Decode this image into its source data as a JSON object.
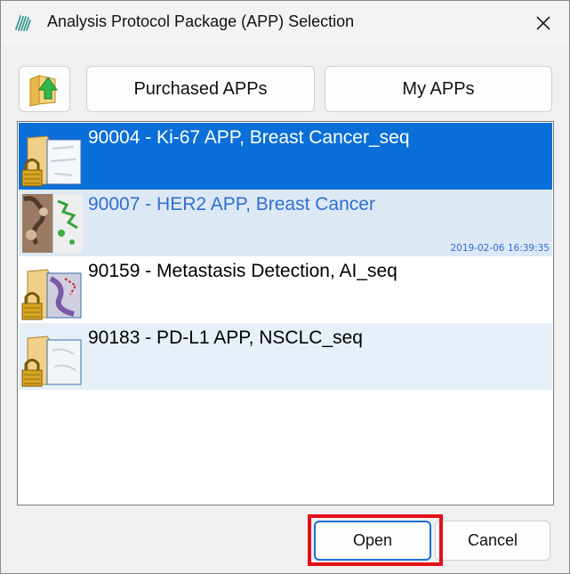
{
  "window": {
    "title": "Analysis Protocol Package (APP) Selection",
    "icon": "app-logo-icon",
    "close_icon": "close-icon"
  },
  "toolbar": {
    "folder_up_icon": "folder-up-icon",
    "purchased_label": "Purchased APPs",
    "myapps_label": "My APPs"
  },
  "list": {
    "items": [
      {
        "label": "90004 - Ki-67 APP, Breast Cancer_seq",
        "timestamp": "",
        "state": "selected",
        "locked": true,
        "icon": "locked-folder-thumbnail-icon"
      },
      {
        "label": "90007 - HER2 APP, Breast Cancer",
        "timestamp": "2019-02-06 16:39:35",
        "state": "hover",
        "locked": false,
        "icon": "tissue-thumbnail-icon"
      },
      {
        "label": "90159 - Metastasis Detection, AI_seq",
        "timestamp": "",
        "state": "normal",
        "locked": true,
        "icon": "locked-folder-thumbnail-icon"
      },
      {
        "label": "90183 - PD-L1 APP, NSCLC_seq",
        "timestamp": "",
        "state": "alt",
        "locked": true,
        "icon": "locked-folder-thumbnail-icon"
      }
    ]
  },
  "buttons": {
    "open_label": "Open",
    "cancel_label": "Cancel"
  },
  "colors": {
    "selected_bg": "#0a6fd8",
    "hover_bg": "#dde8f5",
    "alt_bg": "#e7eff8",
    "hover_text": "#2f6fd0",
    "highlight": "#e3101a",
    "lock": "#c8a020"
  }
}
